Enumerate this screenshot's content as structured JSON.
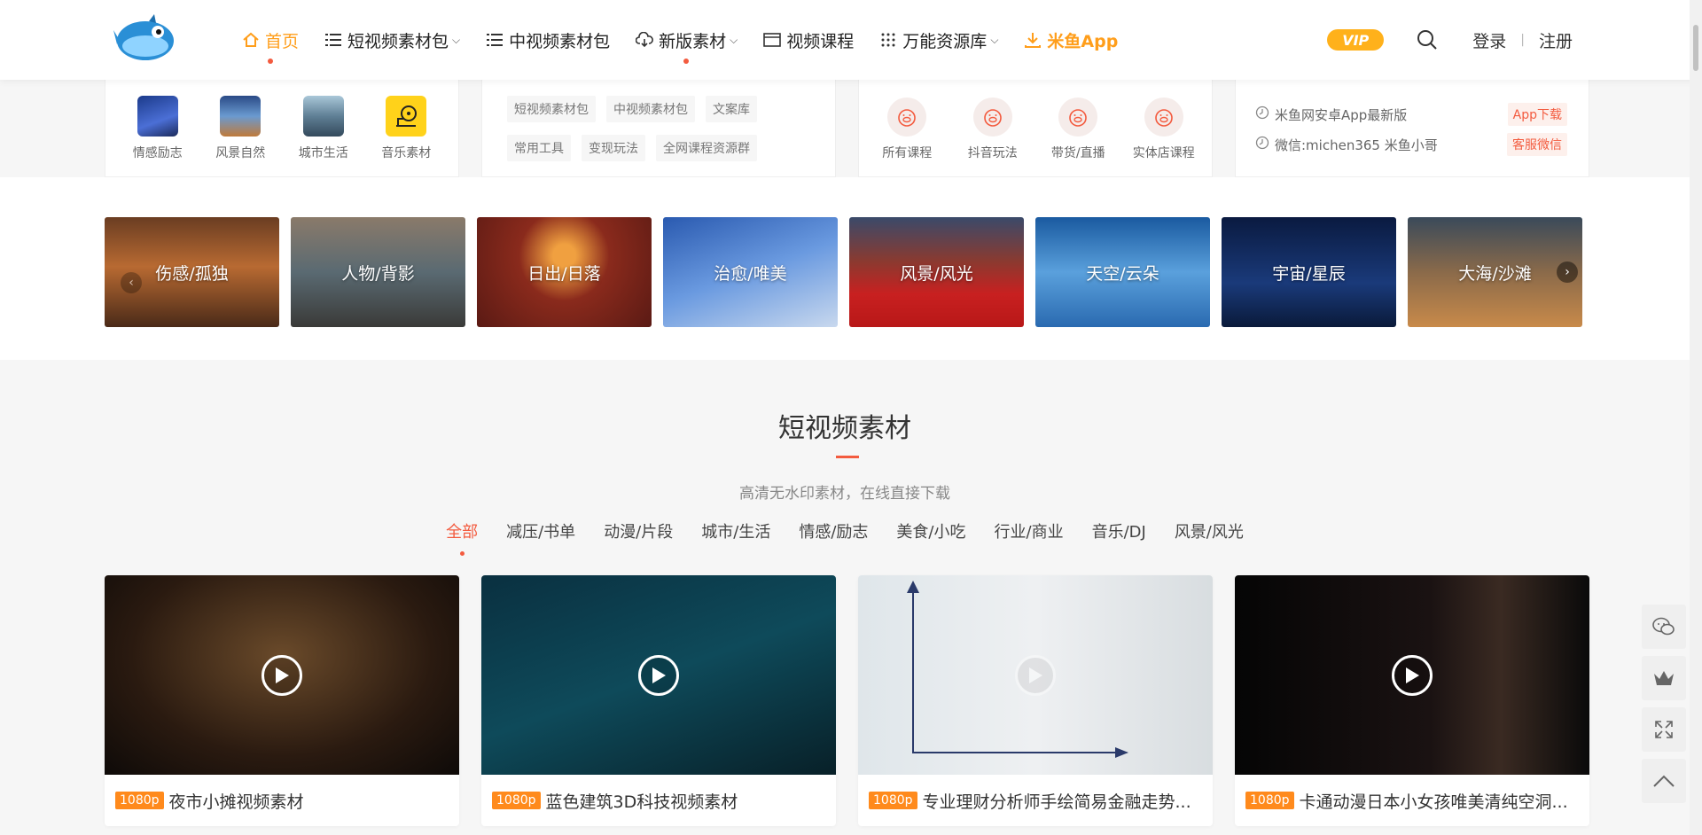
{
  "header": {
    "nav": [
      {
        "label": "首页",
        "icon": "home-icon",
        "active": true
      },
      {
        "label": "短视频素材包",
        "icon": "list-icon",
        "dropdown": true
      },
      {
        "label": "中视频素材包",
        "icon": "list-icon"
      },
      {
        "label": "新版素材",
        "icon": "cloud-icon",
        "dropdown": true
      },
      {
        "label": "视频课程",
        "icon": "window-icon"
      },
      {
        "label": "万能资源库",
        "icon": "grid-icon",
        "dropdown": true
      },
      {
        "label": "米鱼App",
        "icon": "download-icon"
      }
    ],
    "vip_label": "VIP",
    "login": "登录",
    "register": "注册"
  },
  "top_boxes": {
    "categories": [
      {
        "label": "情感励志"
      },
      {
        "label": "风景自然"
      },
      {
        "label": "城市生活"
      },
      {
        "label": "音乐素材"
      }
    ],
    "tags": [
      "短视频素材包",
      "中视频素材包",
      "文案库",
      "常用工具",
      "变现玩法",
      "全网课程资源群"
    ],
    "courses": [
      {
        "label": "所有课程"
      },
      {
        "label": "抖音玩法"
      },
      {
        "label": "带货/直播"
      },
      {
        "label": "实体店课程"
      }
    ],
    "info": [
      {
        "text": "米鱼网安卓App最新版",
        "button": "App下载"
      },
      {
        "text": "微信:michen365 米鱼小哥",
        "button": "客服微信"
      }
    ]
  },
  "carousel": [
    {
      "label": "伤感/孤独"
    },
    {
      "label": "人物/背影"
    },
    {
      "label": "日出/日落"
    },
    {
      "label": "治愈/唯美"
    },
    {
      "label": "风景/风光"
    },
    {
      "label": "天空/云朵"
    },
    {
      "label": "宇宙/星辰"
    },
    {
      "label": "大海/沙滩"
    }
  ],
  "section": {
    "title": "短视频素材",
    "subtitle": "高清无水印素材，在线直接下载",
    "filters": [
      "全部",
      "减压/书单",
      "动漫/片段",
      "城市/生活",
      "情感/励志",
      "美食/小吃",
      "行业/商业",
      "音乐/DJ",
      "风景/风光"
    ],
    "active_filter": "全部"
  },
  "cards": [
    {
      "resolution": "1080p",
      "title": "夜市小摊视频素材"
    },
    {
      "resolution": "1080p",
      "title": "蓝色建筑3D科技视频素材"
    },
    {
      "resolution": "1080p",
      "title": "专业理财分析师手绘简易金融走势..."
    },
    {
      "resolution": "1080p",
      "title": "卡通动漫日本小女孩唯美清纯空洞..."
    }
  ]
}
